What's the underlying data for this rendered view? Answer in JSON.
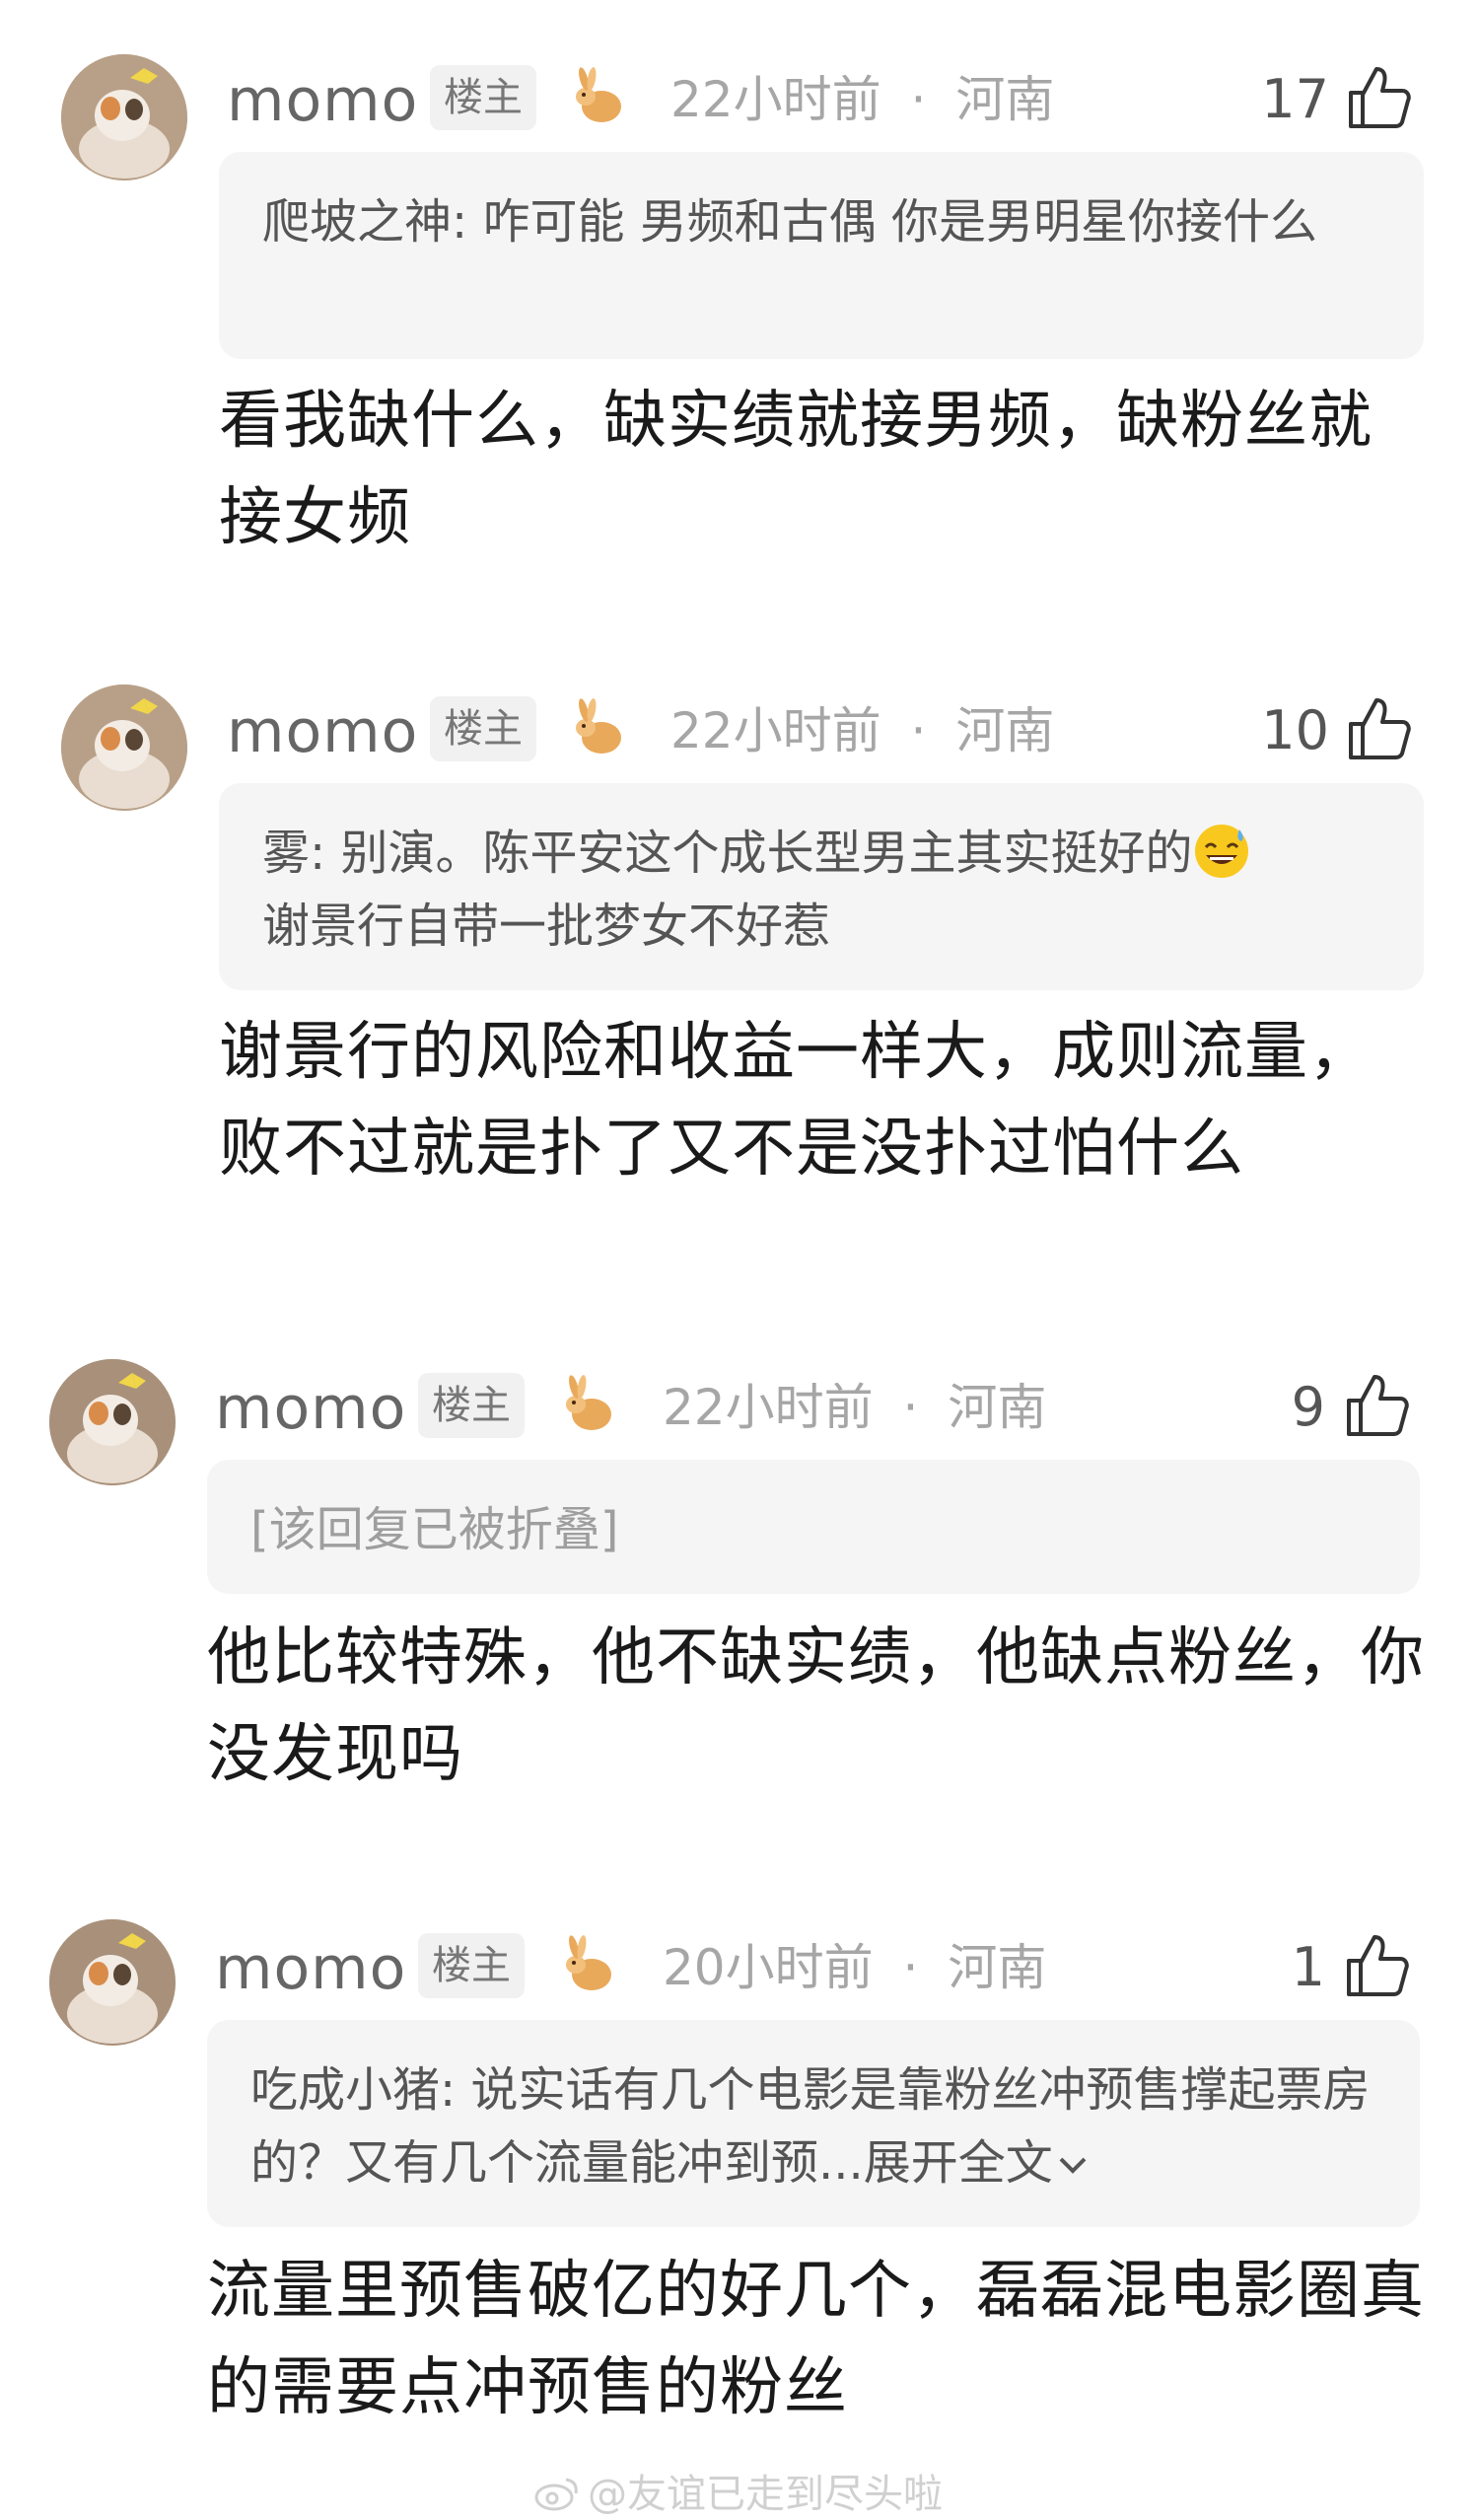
{
  "comments": [
    {
      "username": "momo",
      "badge": "楼主",
      "time": "22小时前",
      "separator": "·",
      "location": "河南",
      "likes": "17",
      "quote_user": "爬坡之神:",
      "quote_text": " 咋可能 男频和古偶 你是男明星你接什么",
      "reply": "看我缺什么，缺实绩就接男频，缺粉丝就接女频"
    },
    {
      "username": "momo",
      "badge": "楼主",
      "time": "22小时前",
      "separator": "·",
      "location": "河南",
      "likes": "10",
      "quote_user": "雾:",
      "quote_text": " 别演。陈平安这个成长型男主其实挺好的",
      "quote_text2": "谢景行自带一批梦女不好惹",
      "reply": "谢景行的风险和收益一样大，成则流量，败不过就是扑了又不是没扑过怕什么"
    },
    {
      "username": "momo",
      "badge": "楼主",
      "time": "22小时前",
      "separator": "·",
      "location": "河南",
      "likes": "9",
      "quote_folded": "[该回复已被折叠]",
      "reply": "他比较特殊，他不缺实绩，他缺点粉丝，你没发现吗"
    },
    {
      "username": "momo",
      "badge": "楼主",
      "time": "20小时前",
      "separator": "·",
      "location": "河南",
      "likes": "1",
      "quote_user": "吃成小猪:",
      "quote_text": " 说实话有几个电影是靠粉丝冲预售撑起票房的？又有几个流量能冲到预...",
      "expand_label": "展开全文",
      "reply": "流量里预售破亿的好几个，磊磊混电影圈真的需要点冲预售的粉丝"
    }
  ],
  "watermark": "@友谊已走到尽头啦",
  "colors": {
    "background": "#ffffff",
    "quote_bg": "#f5f5f5",
    "meta_text": "#a6a6a6",
    "reply_text": "#1a1a1a"
  },
  "icons": {
    "like": "thumbs-up-icon",
    "medal": "rabbit-medal-icon",
    "expand": "chevron-down-icon",
    "emoji": "sweat-smile-emoji",
    "watermark": "weibo-logo-icon"
  }
}
